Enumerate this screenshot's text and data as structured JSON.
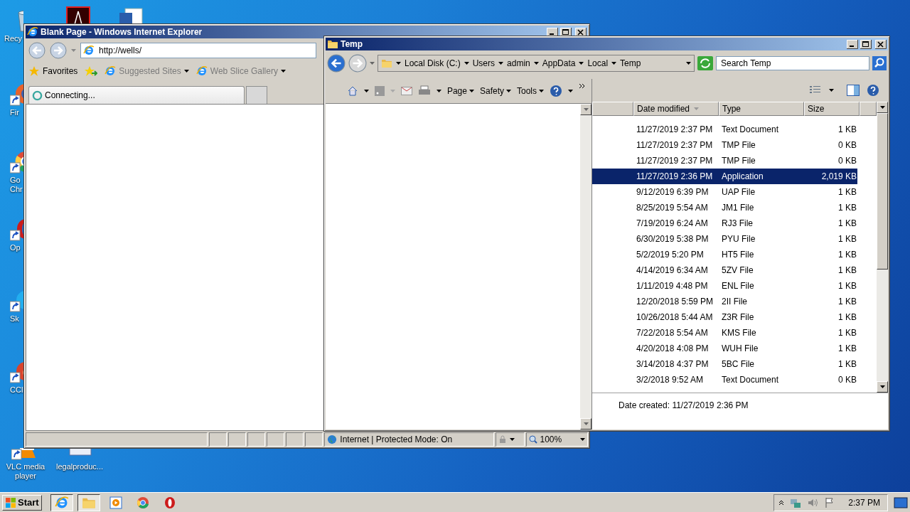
{
  "desktop_icons": [
    {
      "kind": "recycle-bin",
      "shortcut": false,
      "lines": [
        "Recy"
      ]
    },
    {
      "kind": "acrobat",
      "shortcut": false
    },
    {
      "kind": "word",
      "shortcut": false
    },
    {
      "kind": "firefox",
      "shortcut": true,
      "lines": [
        "Fir"
      ]
    },
    {
      "kind": "chrome",
      "shortcut": true,
      "lines": [
        "Go",
        "Chr"
      ]
    },
    {
      "kind": "opera",
      "shortcut": true,
      "lines": [
        "Op"
      ]
    },
    {
      "kind": "skype",
      "shortcut": true,
      "lines": [
        "Sk"
      ]
    },
    {
      "kind": "ccleaner",
      "shortcut": true,
      "lines": [
        "CCl"
      ]
    },
    {
      "kind": "vlc",
      "shortcut": true,
      "lines": [
        "VLC media",
        "player"
      ]
    },
    {
      "kind": "document",
      "shortcut": false,
      "lines": [
        "legalproduc..."
      ]
    }
  ],
  "ie_window": {
    "title": "Blank Page - Windows Internet Explorer",
    "address": "http://wells/",
    "favorites": {
      "label": "Favorites",
      "links": [
        {
          "label": "Suggested Sites"
        },
        {
          "label": "Web Slice Gallery"
        }
      ]
    },
    "tab": {
      "label": "Connecting..."
    },
    "command_bar": [
      {
        "label": "Page"
      },
      {
        "label": "Safety"
      },
      {
        "label": "Tools"
      }
    ],
    "status_bar": {
      "zone": "Internet | Protected Mode: On",
      "zoom": "100%"
    }
  },
  "explorer_window": {
    "title": "Temp",
    "breadcrumb": [
      "Local Disk (C:)",
      "Users",
      "admin",
      "AppData",
      "Local",
      "Temp"
    ],
    "search": {
      "placeholder": "Search Temp"
    },
    "columns": [
      {
        "label": "Date modified",
        "sorted": true
      },
      {
        "label": "Type",
        "sorted": false
      },
      {
        "label": "Size",
        "sorted": false
      }
    ],
    "rows": [
      {
        "date": "11/27/2019 2:37 PM",
        "type": "Text Document",
        "size": "1 KB",
        "selected": false
      },
      {
        "date": "11/27/2019 2:37 PM",
        "type": "TMP File",
        "size": "0 KB",
        "selected": false
      },
      {
        "date": "11/27/2019 2:37 PM",
        "type": "TMP File",
        "size": "0 KB",
        "selected": false
      },
      {
        "date": "11/27/2019 2:36 PM",
        "type": "Application",
        "size": "2,019 KB",
        "selected": true
      },
      {
        "date": "9/12/2019 6:39 PM",
        "type": "UAP File",
        "size": "1 KB",
        "selected": false
      },
      {
        "date": "8/25/2019 5:54 AM",
        "type": "JM1 File",
        "size": "1 KB",
        "selected": false
      },
      {
        "date": "7/19/2019 6:24 AM",
        "type": "RJ3 File",
        "size": "1 KB",
        "selected": false
      },
      {
        "date": "6/30/2019 5:38 PM",
        "type": "PYU File",
        "size": "1 KB",
        "selected": false
      },
      {
        "date": "5/2/2019 5:20 PM",
        "type": "HT5 File",
        "size": "1 KB",
        "selected": false
      },
      {
        "date": "4/14/2019 6:34 AM",
        "type": "5ZV File",
        "size": "1 KB",
        "selected": false
      },
      {
        "date": "1/11/2019 4:48 PM",
        "type": "ENL File",
        "size": "1 KB",
        "selected": false
      },
      {
        "date": "12/20/2018 5:59 PM",
        "type": "2II File",
        "size": "1 KB",
        "selected": false
      },
      {
        "date": "10/26/2018 5:44 AM",
        "type": "Z3R File",
        "size": "1 KB",
        "selected": false
      },
      {
        "date": "7/22/2018 5:54 AM",
        "type": "KMS File",
        "size": "1 KB",
        "selected": false
      },
      {
        "date": "4/20/2018 4:08 PM",
        "type": "WUH File",
        "size": "1 KB",
        "selected": false
      },
      {
        "date": "3/14/2018 4:37 PM",
        "type": "5BC File",
        "size": "1 KB",
        "selected": false
      },
      {
        "date": "3/2/2018 9:52 AM",
        "type": "Text Document",
        "size": "0 KB",
        "selected": false
      }
    ],
    "details": "Date created: 11/27/2019 2:36 PM"
  },
  "taskbar": {
    "start": "Start",
    "apps": [
      {
        "kind": "ie",
        "open": true
      },
      {
        "kind": "explorer",
        "open": true
      },
      {
        "kind": "media",
        "open": false
      },
      {
        "kind": "chrome",
        "open": false
      },
      {
        "kind": "opera",
        "open": false
      }
    ],
    "clock": "2:37 PM"
  }
}
